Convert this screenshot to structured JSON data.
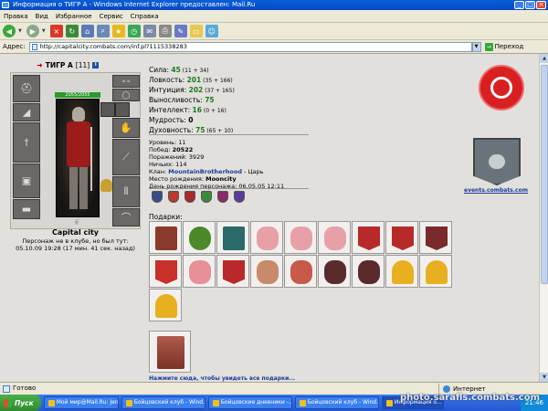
{
  "window": {
    "title": "Информация о ТИГР А - Windows Internet Explorer предоставлен: Mail.Ru",
    "minimize": "_",
    "maximize": "□",
    "close": "×"
  },
  "menu": [
    "Правка",
    "Вид",
    "Избранное",
    "Сервис",
    "Справка"
  ],
  "toolbar_icons": [
    "back-icon",
    "forward-icon",
    "stop-icon",
    "refresh-icon",
    "home-icon",
    "search-icon",
    "favorites-icon",
    "history-icon",
    "mail-icon",
    "print-icon",
    "edit-icon",
    "folder-icon",
    "messenger-icon"
  ],
  "address": {
    "label": "Адрес:",
    "url": "http://capitalcity.combats.com/inf.pl?1115338283",
    "go_label": "Переход"
  },
  "character": {
    "name": "ТИГР А",
    "level": "[11]",
    "info_badge": "i",
    "hp": "2055/2055",
    "city": "Capital city",
    "status_line1": "Персонаж не в клубе, но был тут:",
    "status_line2": "05.10.09 19:28 (17 мин. 41 сек. назад)"
  },
  "stats": [
    {
      "label": "Сила: ",
      "value": "45",
      "bonus": " (11 + 34)"
    },
    {
      "label": "Ловкость: ",
      "value": "201",
      "bonus": " (35 + 166)"
    },
    {
      "label": "Интуиция: ",
      "value": "202",
      "bonus": " (37 + 165)"
    },
    {
      "label": "Выносливость: ",
      "value": "75",
      "bonus": ""
    },
    {
      "label": "Интеллект: ",
      "value": "16",
      "bonus": " (0 + 16)"
    },
    {
      "label": "Мудрость: ",
      "value": "0",
      "bonus": ""
    },
    {
      "label": "Духовность: ",
      "value": "75",
      "bonus": " (65 + 10)"
    }
  ],
  "info": {
    "level_label": "Уровень: ",
    "level_value": "11",
    "wins_label": "Побед: ",
    "wins_value": "20522",
    "losses_label": "Поражений: ",
    "losses_value": "3929",
    "draws_label": "Ничьих: ",
    "draws_value": "114",
    "clan_label": "Клан: ",
    "clan_name": "MountainBrotherhood",
    "clan_rank": " - Царь",
    "birthplace_label": "Место рождения: ",
    "birthplace_value": "Mooncity",
    "birthday_label": "День рождения персонажа: ",
    "birthday_value": "06.05.05 12:11"
  },
  "badges": [
    {
      "icon": "shield-badge-icon",
      "color": "#3a4a8a"
    },
    {
      "icon": "shield-badge-icon",
      "color": "#b83a2a"
    },
    {
      "icon": "shield-badge-icon",
      "color": "#a82a2a"
    },
    {
      "icon": "shield-badge-icon",
      "color": "#3a8a3a"
    },
    {
      "icon": "shield-badge-icon",
      "color": "#8a2a6a"
    },
    {
      "icon": "shield-badge-icon",
      "color": "#5a3a9a"
    }
  ],
  "events_link": "events.combats.com",
  "gifts_label": "Подарки:",
  "gifts": [
    {
      "icon": "book-gift-icon",
      "color": "#8a3a2a"
    },
    {
      "icon": "wreath-gift-icon",
      "color": "#4a8a2a"
    },
    {
      "icon": "tome-gift-icon",
      "color": "#2a6a6a"
    },
    {
      "icon": "viking-pig-gift-icon",
      "color": "#e8a0a8"
    },
    {
      "icon": "viking-pig-gift-icon",
      "color": "#e8a0a8"
    },
    {
      "icon": "viking-pig-gift-icon",
      "color": "#e8a0a8"
    },
    {
      "icon": "banner-gift-icon",
      "color": "#b82a2a"
    },
    {
      "icon": "banner-gift-icon",
      "color": "#b82a2a"
    },
    {
      "icon": "banner-gift-icon",
      "color": "#7a2a2a"
    },
    {
      "icon": "lion-banner-gift-icon",
      "color": "#c8302a"
    },
    {
      "icon": "santa-pig-gift-icon",
      "color": "#e89098"
    },
    {
      "icon": "banner-gift-icon",
      "color": "#b82a2a"
    },
    {
      "icon": "teddy-bear-gift-icon",
      "color": "#c88a6a"
    },
    {
      "icon": "santa-bear-gift-icon",
      "color": "#c85a4a"
    },
    {
      "icon": "dark-bear-gift-icon",
      "color": "#5a2a2a"
    },
    {
      "icon": "dark-bear-gift-icon",
      "color": "#5a2a2a"
    },
    {
      "icon": "bell-gift-icon",
      "color": "#e8b020"
    },
    {
      "icon": "bell-gift-icon",
      "color": "#e8b020"
    },
    {
      "icon": "bell-gift-icon",
      "color": "#e8b020"
    }
  ],
  "all_gifts_link": "Нажмите сюда, чтобы увидеть все подарки...",
  "statusbar": {
    "text": "Готово",
    "zone": "Интернет"
  },
  "taskbar": {
    "start": "Пуск",
    "tasks": [
      "Мой мир@Mail.Ru: Jene...",
      "Бойцовский клуб - Wind...",
      "Бойцовские дневники -...",
      "Бойцовский клуб - Wind...",
      "Информация о..."
    ],
    "time": "21:46"
  },
  "watermark": "photo.sarafls.combats.com"
}
